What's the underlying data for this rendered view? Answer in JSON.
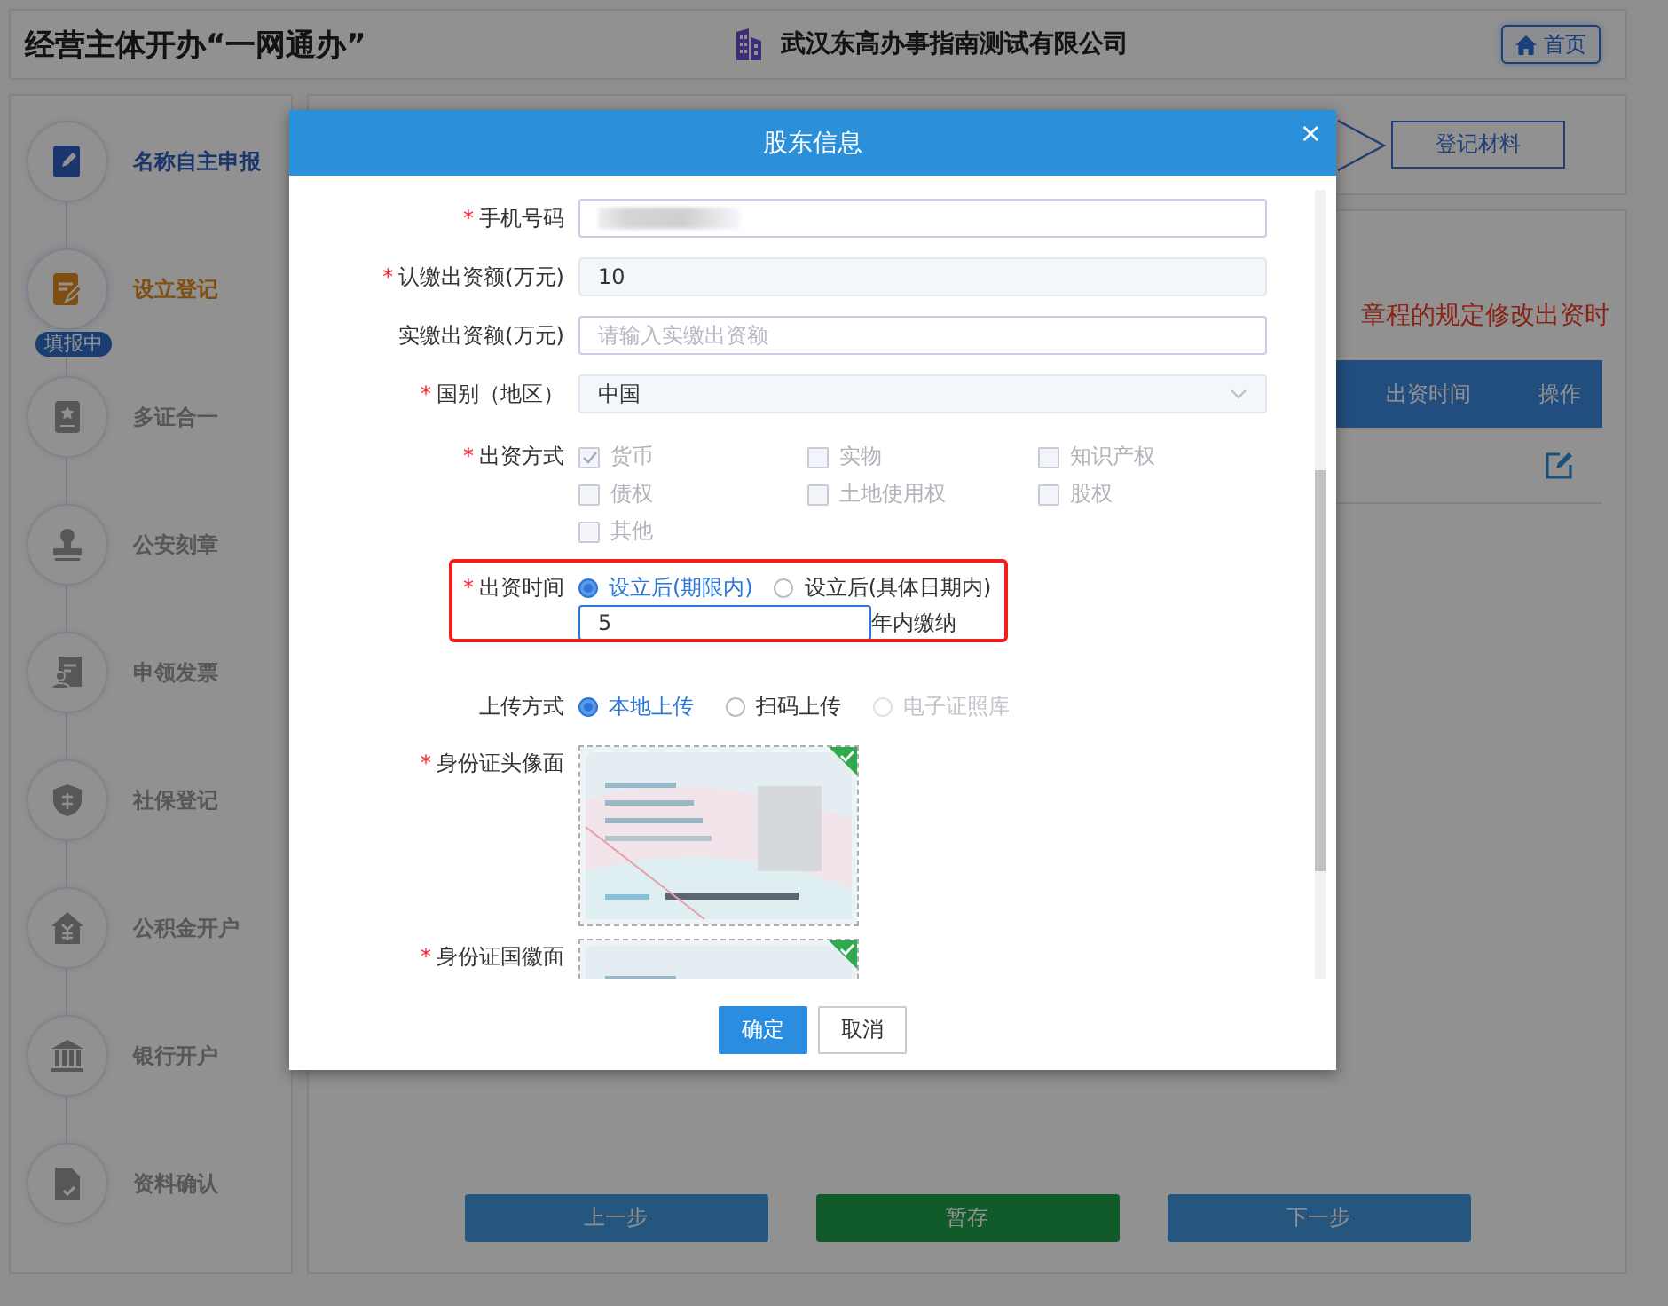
{
  "header": {
    "title": "经营主体开办“一网通办”",
    "company": "武汉东高办事指南测试有限公司",
    "home_button": "首页"
  },
  "sidebar": {
    "steps": [
      {
        "label": "名称自主申报",
        "done": true,
        "current": false
      },
      {
        "label": "设立登记",
        "done": false,
        "current": true,
        "badge": "填报中"
      },
      {
        "label": "多证合一",
        "done": false,
        "current": false
      },
      {
        "label": "公安刻章",
        "done": false,
        "current": false
      },
      {
        "label": "申领发票",
        "done": false,
        "current": false
      },
      {
        "label": "社保登记",
        "done": false,
        "current": false
      },
      {
        "label": "公积金开户",
        "done": false,
        "current": false
      },
      {
        "label": "银行开户",
        "done": false,
        "current": false
      },
      {
        "label": "资料确认",
        "done": false,
        "current": false
      }
    ]
  },
  "step_bar": {
    "steps": [
      {
        "label": "登记材料"
      }
    ]
  },
  "content": {
    "notice": "章程的规定修改出资时",
    "table": {
      "columns": [
        "出资时间",
        "操作"
      ],
      "rows": [
        {
          "kind": "edit"
        }
      ]
    },
    "buttons": [
      {
        "label": "上一步",
        "kind": "prev"
      },
      {
        "label": "暂存",
        "kind": "save"
      },
      {
        "label": "下一步",
        "kind": "next"
      }
    ]
  },
  "dialog": {
    "title": "股东信息",
    "close": "×",
    "fields": [
      {
        "label": "手机号码",
        "mark": "*",
        "kind": "masked"
      },
      {
        "label": "认缴出资额(万元)",
        "mark": "*",
        "kind": "input",
        "value": "10",
        "readonly": true
      },
      {
        "label": "实缴出资额(万元)",
        "kind": "input",
        "placeholder": "请输入实缴出资额",
        "readonly": false
      },
      {
        "label": "国别（地区）",
        "mark": "*",
        "kind": "select",
        "value": "中国"
      },
      {
        "label": "出资方式",
        "mark": "*",
        "kind": "checkboxes",
        "options": [
          {
            "label": "货币",
            "checked": true
          },
          {
            "label": "实物",
            "checked": false
          },
          {
            "label": "知识产权",
            "checked": false
          },
          {
            "label": "债权",
            "checked": false
          },
          {
            "label": "土地使用权",
            "checked": false
          },
          {
            "label": "股权",
            "checked": false
          },
          {
            "label": "其他",
            "checked": false
          }
        ]
      },
      {
        "label": "出资时间",
        "mark": "*",
        "kind": "period",
        "highlighted": true,
        "options": [
          {
            "label": "设立后(期限内)",
            "selected": true
          },
          {
            "label": "设立后(具体日期内)",
            "selected": false
          }
        ],
        "value": "5",
        "suffix": "年内缴纳"
      },
      {
        "label": "上传方式",
        "kind": "radios",
        "options": [
          {
            "label": "本地上传",
            "selected": true,
            "disabled": false
          },
          {
            "label": "扫码上传",
            "selected": false,
            "disabled": false
          },
          {
            "label": "电子证照库",
            "selected": false,
            "disabled": true
          }
        ]
      },
      {
        "label": "身份证头像面",
        "mark": "*",
        "uploaded": true
      },
      {
        "label": "身份证国徽面",
        "mark": "*",
        "uploaded": true
      }
    ],
    "buttons": [
      {
        "label": "确定",
        "primary": true
      },
      {
        "label": "取消",
        "primary": false
      }
    ]
  }
}
